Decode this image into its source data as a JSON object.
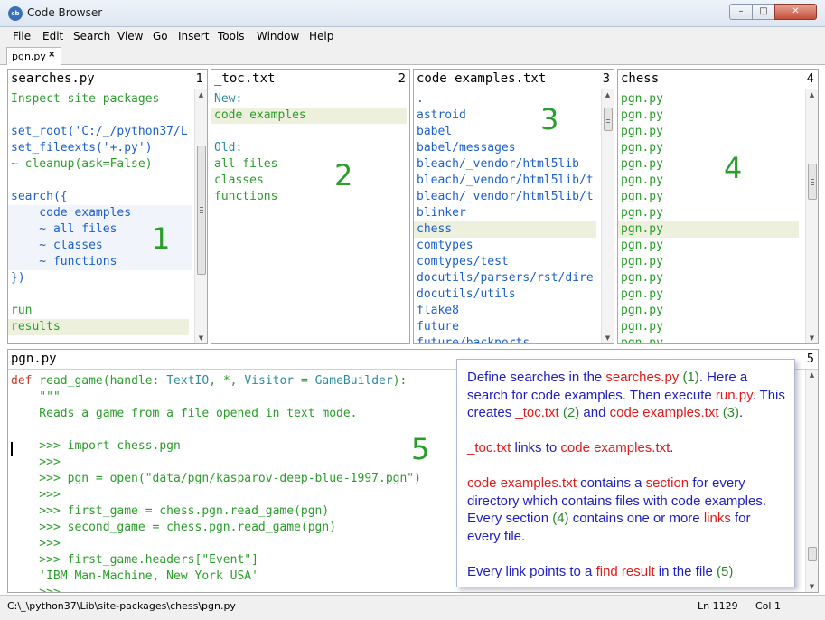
{
  "window": {
    "title": "Code Browser",
    "icon": "cb",
    "minimize": "–",
    "maximize": "□",
    "close": "✕"
  },
  "menu": [
    "File",
    "Edit",
    "Search",
    "View",
    "Go",
    "Insert",
    "Tools",
    "Window",
    "Help"
  ],
  "tab": {
    "label": "pgn.py",
    "close": "×"
  },
  "colors": {
    "green": "#2a9d2a",
    "blue": "#1c60c8",
    "teal": "#2b8ca0",
    "red": "#c0392b",
    "callout_blue": "#2020c0",
    "callout_red": "#e01b1b"
  },
  "panes": {
    "p1": {
      "title": "searches.py",
      "num": "1",
      "lines": [
        "Inspect site-packages",
        "",
        "set_root('C:/_/python37/L",
        "set_fileexts('+.py')",
        "~ cleanup(ask=False)",
        "",
        "search({",
        "    code examples",
        "    ~ all files",
        "    ~ classes",
        "    ~ functions",
        "})",
        "",
        "run",
        "results"
      ]
    },
    "p2": {
      "title": "_toc.txt",
      "num": "2",
      "lines": [
        "New:",
        "code examples",
        "",
        "Old:",
        "all files",
        "classes",
        "functions"
      ]
    },
    "p3": {
      "title": "code examples.txt",
      "num": "3",
      "lines": [
        ".",
        "astroid",
        "babel",
        "babel/messages",
        "bleach/_vendor/html5lib",
        "bleach/_vendor/html5lib/t",
        "bleach/_vendor/html5lib/t",
        "blinker",
        "chess",
        "comtypes",
        "comtypes/test",
        "docutils/parsers/rst/dire",
        "docutils/utils",
        "flake8",
        "future",
        "future/backports"
      ]
    },
    "p4": {
      "title": "chess",
      "num": "4",
      "lines": [
        "pgn.py",
        "pgn.py",
        "pgn.py",
        "pgn.py",
        "pgn.py",
        "pgn.py",
        "pgn.py",
        "pgn.py",
        "pgn.py",
        "pgn.py",
        "pgn.py",
        "pgn.py",
        "pgn.py",
        "pgn.py",
        "pgn.py",
        "pgn.py"
      ]
    },
    "p5": {
      "title": "pgn.py",
      "num": "5",
      "code": {
        "def": "def",
        "fname": "read_game",
        "p1": "(handle: ",
        "t1": "TextIO",
        "p2": ", *, ",
        "t2": "Visitor",
        "p3": " = ",
        "t3": "GameBuilder",
        "p4": "):"
      },
      "lines": [
        "    \"\"\"",
        "    Reads a game from a file opened in text mode.",
        "",
        "    >>> import chess.pgn",
        "    >>>",
        "    >>> pgn = open(\"data/pgn/kasparov-deep-blue-1997.pgn\")",
        "    >>>",
        "    >>> first_game = chess.pgn.read_game(pgn)",
        "    >>> second_game = chess.pgn.read_game(pgn)",
        "    >>>",
        "    >>> first_game.headers[\"Event\"]",
        "    'IBM Man-Machine, New York USA'",
        "    >>>"
      ]
    }
  },
  "big_numbers": [
    "1",
    "2",
    "3",
    "4",
    "5"
  ],
  "callout": {
    "p1": {
      "a": "Define searches in the ",
      "b": "searches.py",
      "c": " ",
      "d": "(1)",
      "e": ". Here a search for code examples. Then execute ",
      "f": "run.py",
      "g": ". This creates ",
      "h": "_toc.txt",
      "i": " ",
      "j": "(2)",
      "k": " and ",
      "l": "code examples.txt",
      "m": " ",
      "n": "(3)",
      "o": "."
    },
    "p2": {
      "a": "_toc.txt",
      "b": " links to ",
      "c": "code examples.txt",
      "d": "."
    },
    "p3": {
      "a": "code examples.txt",
      "b": " contains a ",
      "c": "section",
      "d": " for every directory which contains files with code examples. Every section ",
      "e": "(4)",
      "f": " contains one or more ",
      "g": "links",
      "h": " for every file."
    },
    "p4": {
      "a": "Every link points to a ",
      "b": "find result",
      "c": " in the file ",
      "d": "(5)"
    }
  },
  "status": {
    "path": "C:\\_\\python37\\Lib\\site-packages\\chess\\pgn.py",
    "ln": "Ln 1129",
    "col": "Col 1"
  }
}
